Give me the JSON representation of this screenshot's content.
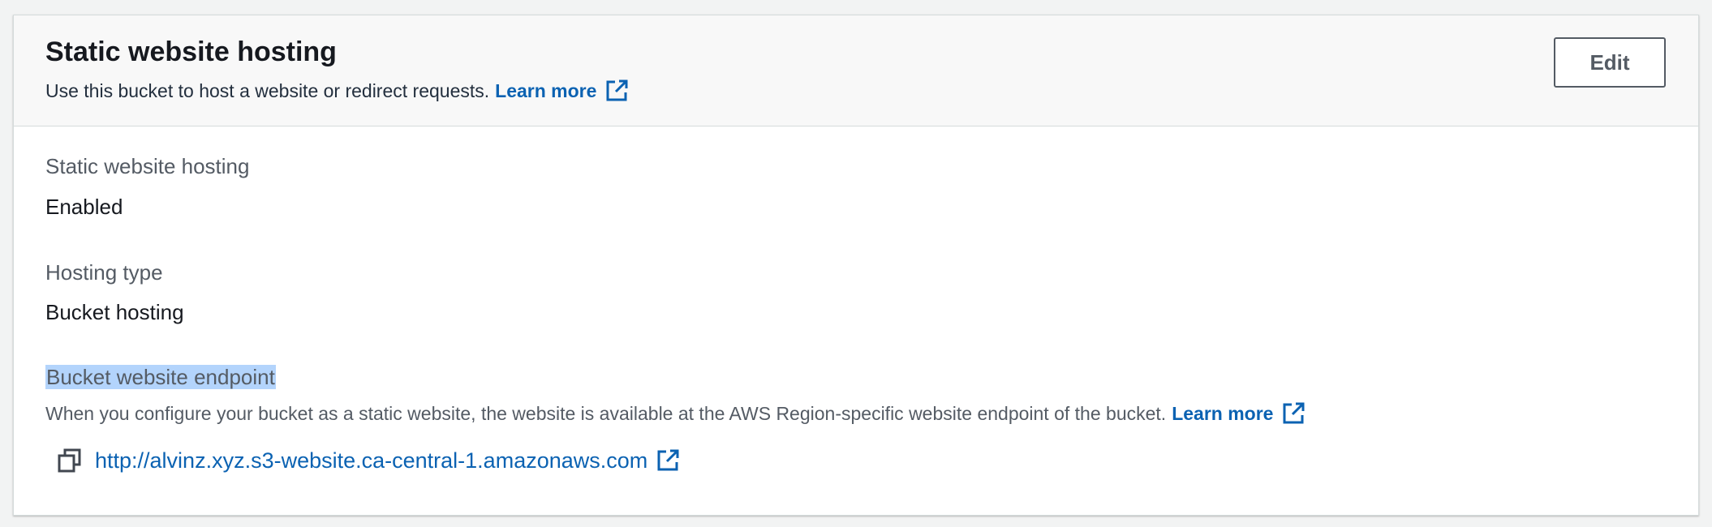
{
  "header": {
    "title": "Static website hosting",
    "description": "Use this bucket to host a website or redirect requests.",
    "learn_more": "Learn more",
    "edit_label": "Edit"
  },
  "fields": {
    "hosting": {
      "label": "Static website hosting",
      "value": "Enabled"
    },
    "hosting_type": {
      "label": "Hosting type",
      "value": "Bucket hosting"
    },
    "endpoint": {
      "label": "Bucket website endpoint",
      "description": "When you configure your bucket as a static website, the website is available at the AWS Region-specific website endpoint of the bucket.",
      "learn_more": "Learn more",
      "url": "http://alvinz.xyz.s3-website.ca-central-1.amazonaws.com"
    }
  },
  "icons": {
    "external_link": "external-link-icon",
    "copy": "copy-icon"
  },
  "colors": {
    "link": "#0b62b2",
    "selection_highlight": "#b3d4fc",
    "header_background": "#f8f8f8"
  }
}
